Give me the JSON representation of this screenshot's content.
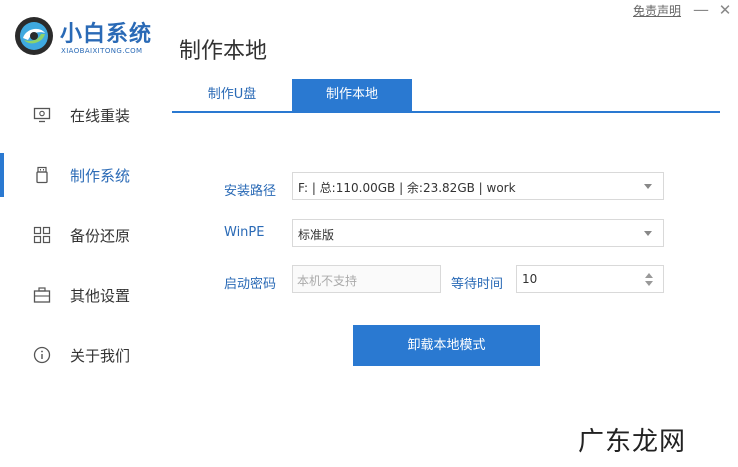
{
  "logo": {
    "name": "小白系统",
    "subtitle": "XIAOBAIXITONG.COM",
    "brand_color": "#2a6ab6"
  },
  "page_title": "制作本地",
  "window": {
    "disclaimer": "免责声明",
    "minimize": "—",
    "close": "✕"
  },
  "sidebar": {
    "items": [
      {
        "label": "在线重装",
        "icon": "monitor-icon",
        "active": false
      },
      {
        "label": "制作系统",
        "icon": "usb-drive-icon",
        "active": true
      },
      {
        "label": "备份还原",
        "icon": "grid-restore-icon",
        "active": false
      },
      {
        "label": "其他设置",
        "icon": "briefcase-icon",
        "active": false
      },
      {
        "label": "关于我们",
        "icon": "info-icon",
        "active": false
      }
    ]
  },
  "tabs": [
    {
      "label": "制作U盘",
      "active": false
    },
    {
      "label": "制作本地",
      "active": true
    }
  ],
  "form": {
    "install_path": {
      "label": "安装路径",
      "value": "F: | 总:110.00GB | 余:23.82GB | work"
    },
    "winpe": {
      "label": "WinPE",
      "value": "标准版"
    },
    "boot_password": {
      "label": "启动密码",
      "placeholder": "本机不支持"
    },
    "wait_time": {
      "label": "等待时间",
      "value": "10"
    }
  },
  "actions": {
    "uninstall_label": "卸载本地模式"
  },
  "watermark": "广东龙网",
  "colors": {
    "accent": "#2a79d1",
    "text": "#333333",
    "border": "#d9d9d9"
  }
}
